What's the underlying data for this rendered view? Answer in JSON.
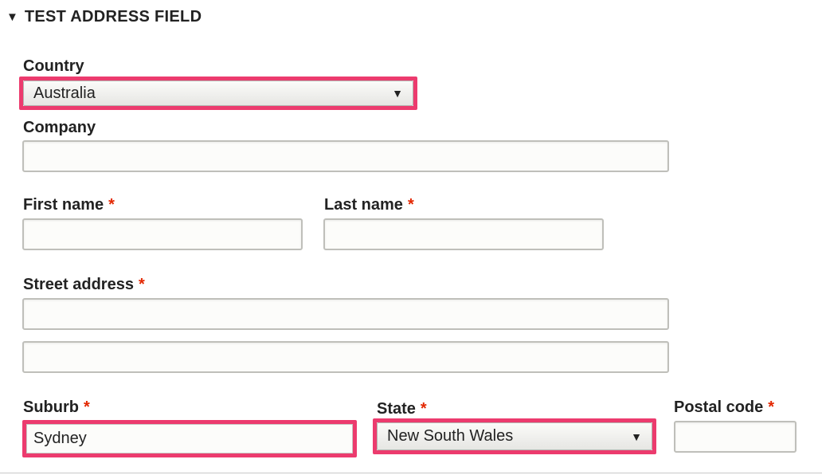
{
  "section": {
    "title": "TEST ADDRESS FIELD",
    "toggle_icon": "triangle-down-icon"
  },
  "fields": {
    "country": {
      "label": "Country",
      "value": "Australia"
    },
    "company": {
      "label": "Company",
      "value": ""
    },
    "first_name": {
      "label": "First name",
      "required": "*",
      "value": ""
    },
    "last_name": {
      "label": "Last name",
      "required": "*",
      "value": ""
    },
    "street_address": {
      "label": "Street address",
      "required": "*",
      "line1": "",
      "line2": ""
    },
    "suburb": {
      "label": "Suburb",
      "required": "*",
      "value": "Sydney"
    },
    "state": {
      "label": "State",
      "required": "*",
      "value": "New South Wales"
    },
    "postal_code": {
      "label": "Postal code",
      "required": "*",
      "value": ""
    }
  },
  "colors": {
    "highlight": "#ec3b6e",
    "required": "#e32700",
    "text": "#222222"
  }
}
